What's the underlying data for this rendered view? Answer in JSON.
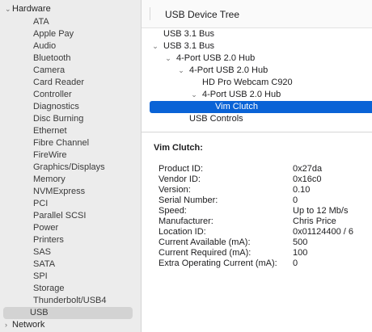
{
  "sidebar": {
    "hardware_group": "Hardware",
    "network_group": "Network",
    "items": [
      "ATA",
      "Apple Pay",
      "Audio",
      "Bluetooth",
      "Camera",
      "Card Reader",
      "Controller",
      "Diagnostics",
      "Disc Burning",
      "Ethernet",
      "Fibre Channel",
      "FireWire",
      "Graphics/Displays",
      "Memory",
      "NVMExpress",
      "PCI",
      "Parallel SCSI",
      "Power",
      "Printers",
      "SAS",
      "SATA",
      "SPI",
      "Storage",
      "Thunderbolt/USB4",
      "USB"
    ],
    "selected": "USB"
  },
  "tree": {
    "header": "USB Device Tree",
    "rows": [
      {
        "label": "USB 3.1 Bus"
      },
      {
        "label": "USB 3.1 Bus"
      },
      {
        "label": "4-Port USB 2.0 Hub"
      },
      {
        "label": "4-Port USB 2.0 Hub"
      },
      {
        "label": "HD Pro Webcam C920"
      },
      {
        "label": "4-Port USB 2.0 Hub"
      },
      {
        "label": "Vim Clutch"
      },
      {
        "label": "USB Controls"
      }
    ]
  },
  "details": {
    "title": "Vim Clutch:",
    "properties": [
      {
        "key": "Product ID:",
        "value": "0x27da"
      },
      {
        "key": "Vendor ID:",
        "value": "0x16c0"
      },
      {
        "key": "Version:",
        "value": "0.10"
      },
      {
        "key": "Serial Number:",
        "value": "0"
      },
      {
        "key": "Speed:",
        "value": "Up to 12 Mb/s"
      },
      {
        "key": "Manufacturer:",
        "value": "Chris Price"
      },
      {
        "key": "Location ID:",
        "value": "0x01124400 / 6"
      },
      {
        "key": "Current Available (mA):",
        "value": "500"
      },
      {
        "key": "Current Required (mA):",
        "value": "100"
      },
      {
        "key": "Extra Operating Current (mA):",
        "value": "0"
      }
    ]
  },
  "icons": {
    "expanded": "chevron-down-icon",
    "collapsed": "chevron-right-icon"
  },
  "colors": {
    "selection_blue": "#0a63d6",
    "sidebar_bg": "#ececec",
    "sidebar_selected": "#d3d3d3"
  }
}
